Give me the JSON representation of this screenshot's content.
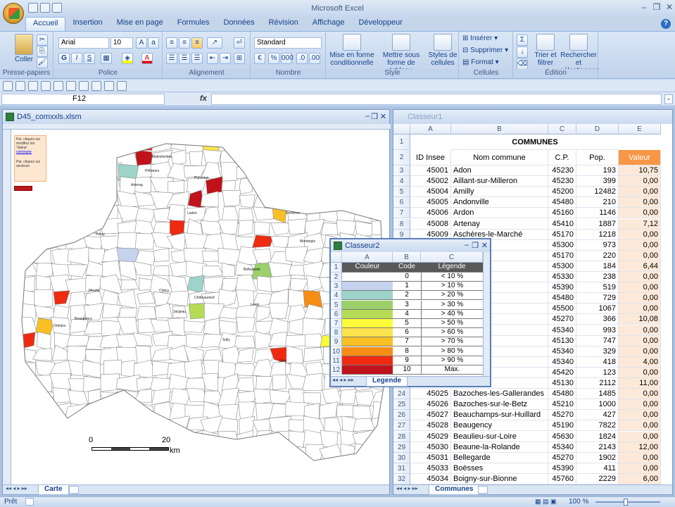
{
  "app": {
    "title": "Microsoft Excel",
    "help": "?"
  },
  "ribbon": {
    "tabs": [
      "Accueil",
      "Insertion",
      "Mise en page",
      "Formules",
      "Données",
      "Révision",
      "Affichage",
      "Développeur"
    ],
    "active_tab": "Accueil",
    "groups": {
      "clipboard": {
        "label": "Presse-papiers",
        "paste": "Coller"
      },
      "font": {
        "label": "Police",
        "font_name": "Arial",
        "font_size": "10"
      },
      "alignment": {
        "label": "Alignement"
      },
      "number": {
        "label": "Nombre",
        "format": "Standard"
      },
      "style": {
        "label": "Style",
        "cond_format": "Mise en forme conditionnelle",
        "table_format": "Mettre sous forme de tableau",
        "cell_styles": "Styles de cellules"
      },
      "cells": {
        "label": "Cellules",
        "insert": "Insérer",
        "delete": "Supprimer",
        "format": "Format"
      },
      "edit": {
        "label": "Édition",
        "sort": "Trier et filtrer",
        "find": "Rechercher et sélectionner"
      }
    }
  },
  "formula_bar": {
    "name_box": "F12",
    "fx": "fx",
    "content": ""
  },
  "windows": {
    "map": {
      "title": "D45_comxxls.xlsm",
      "sheet_tab": "Carte",
      "scale_labels": [
        "0",
        "20",
        "km"
      ],
      "info_lines": [
        "Par. cliquez sur",
        "modifiez les",
        "'Valeur'",
        "commune",
        "Par. cliquez sur",
        "secteurs"
      ],
      "communes_labels": [
        "Orléans",
        "Montargis",
        "Pithiviers",
        "Gien",
        "Briare",
        "Beaugency",
        "Sully",
        "Ladon",
        "Patay",
        "Artenay",
        "Malesherbes",
        "Puiseaux",
        "Bellegarde",
        "Lorris",
        "Châteauneuf",
        "Jargeau",
        "Meung",
        "Chécy",
        "Ferrières",
        "Courtenay"
      ]
    },
    "communes": {
      "title": "Classeur1",
      "sheet_tab": "Communes",
      "columns": [
        "A",
        "B",
        "C",
        "D",
        "E"
      ],
      "header_title": "COMMUNES",
      "headers": [
        "ID Insee",
        "Nom commune",
        "C.P.",
        "Pop.",
        "Valeur"
      ],
      "rows": [
        {
          "r": "3",
          "id": "45001",
          "nom": "Adon",
          "cp": "45230",
          "pop": "193",
          "val": "10,75"
        },
        {
          "r": "4",
          "id": "45002",
          "nom": "Aillant-sur-Milleron",
          "cp": "45230",
          "pop": "399",
          "val": "0,00"
        },
        {
          "r": "5",
          "id": "45004",
          "nom": "Amilly",
          "cp": "45200",
          "pop": "12482",
          "val": "0,00"
        },
        {
          "r": "6",
          "id": "45005",
          "nom": "Andonville",
          "cp": "45480",
          "pop": "210",
          "val": "0,00"
        },
        {
          "r": "7",
          "id": "45006",
          "nom": "Ardon",
          "cp": "45160",
          "pop": "1146",
          "val": "0,00"
        },
        {
          "r": "8",
          "id": "45008",
          "nom": "Artenay",
          "cp": "45410",
          "pop": "1887",
          "val": "7,12"
        },
        {
          "r": "9",
          "id": "45009",
          "nom": "Aschères-le-Marché",
          "cp": "45170",
          "pop": "1218",
          "val": "0,00"
        },
        {
          "r": "10",
          "id": "",
          "nom": "",
          "cp": "45300",
          "pop": "973",
          "val": "0,00"
        },
        {
          "r": "11",
          "id": "",
          "nom": "",
          "cp": "45170",
          "pop": "220",
          "val": "0,00"
        },
        {
          "r": "12",
          "id": "",
          "nom": "",
          "cp": "45300",
          "pop": "184",
          "val": "6,44"
        },
        {
          "r": "13",
          "id": "",
          "nom": "a-Rivière",
          "cp": "45330",
          "pop": "238",
          "val": "0,00"
        },
        {
          "r": "14",
          "id": "",
          "nom": "vière",
          "cp": "45390",
          "pop": "519",
          "val": "0,00"
        },
        {
          "r": "15",
          "id": "",
          "nom": "uine",
          "cp": "45480",
          "pop": "729",
          "val": "0,00"
        },
        {
          "r": "16",
          "id": "",
          "nom": "tel",
          "cp": "45500",
          "pop": "1067",
          "val": "0,00"
        },
        {
          "r": "17",
          "id": "",
          "nom": "n-Gâtinais",
          "cp": "45270",
          "pop": "366",
          "val": "10,08"
        },
        {
          "r": "18",
          "id": "",
          "nom": "",
          "cp": "45340",
          "pop": "993",
          "val": "0,00"
        },
        {
          "r": "19",
          "id": "",
          "nom": "",
          "cp": "45130",
          "pop": "747",
          "val": "0,00"
        },
        {
          "r": "20",
          "id": "",
          "nom": "Gâtinais",
          "cp": "45340",
          "pop": "329",
          "val": "0,00"
        },
        {
          "r": "21",
          "id": "",
          "nom": "âtinais",
          "cp": "45340",
          "pop": "418",
          "val": "4,00"
        },
        {
          "r": "22",
          "id": "",
          "nom": "uisaye",
          "cp": "45420",
          "pop": "123",
          "val": "0,00"
        },
        {
          "r": "23",
          "id": "",
          "nom": "",
          "cp": "45130",
          "pop": "2112",
          "val": "11,00"
        },
        {
          "r": "24",
          "id": "45025",
          "nom": "Bazoches-les-Gallerandes",
          "cp": "45480",
          "pop": "1485",
          "val": "0,00"
        },
        {
          "r": "25",
          "id": "45026",
          "nom": "Bazoches-sur-le-Betz",
          "cp": "45210",
          "pop": "1000",
          "val": "0,00"
        },
        {
          "r": "26",
          "id": "45027",
          "nom": "Beauchamps-sur-Huillard",
          "cp": "45270",
          "pop": "427",
          "val": "0,00"
        },
        {
          "r": "27",
          "id": "45028",
          "nom": "Beaugency",
          "cp": "45190",
          "pop": "7822",
          "val": "0,00"
        },
        {
          "r": "28",
          "id": "45029",
          "nom": "Beaulieu-sur-Loire",
          "cp": "45630",
          "pop": "1824",
          "val": "0,00"
        },
        {
          "r": "29",
          "id": "45030",
          "nom": "Beaune-la-Rolande",
          "cp": "45340",
          "pop": "2143",
          "val": "12,00"
        },
        {
          "r": "30",
          "id": "45031",
          "nom": "Bellegarde",
          "cp": "45270",
          "pop": "1902",
          "val": "0,00"
        },
        {
          "r": "31",
          "id": "45033",
          "nom": "Boësses",
          "cp": "45390",
          "pop": "411",
          "val": "0,00"
        },
        {
          "r": "32",
          "id": "45034",
          "nom": "Boigny-sur-Bionne",
          "cp": "45760",
          "pop": "2229",
          "val": "6,00"
        }
      ]
    },
    "legend": {
      "title": "Classeur2",
      "sheet_tab": "Legende",
      "columns": [
        "A",
        "B",
        "C"
      ],
      "headers": [
        "Couleur",
        "Code",
        "Légende"
      ],
      "rows": [
        {
          "r": "2",
          "code": "0",
          "label": "< 10 %",
          "color": "#ffffff"
        },
        {
          "r": "3",
          "code": "1",
          "label": "> 10 %",
          "color": "#c5d3ef"
        },
        {
          "r": "4",
          "code": "2",
          "label": "> 20 %",
          "color": "#9dd3c9"
        },
        {
          "r": "5",
          "code": "3",
          "label": "> 30 %",
          "color": "#9bd06b"
        },
        {
          "r": "6",
          "code": "4",
          "label": "> 40 %",
          "color": "#b6dc55"
        },
        {
          "r": "7",
          "code": "5",
          "label": "> 50 %",
          "color": "#fbfb39"
        },
        {
          "r": "8",
          "code": "6",
          "label": "> 60 %",
          "color": "#fbe44d"
        },
        {
          "r": "9",
          "code": "7",
          "label": "> 70 %",
          "color": "#f8c025"
        },
        {
          "r": "10",
          "code": "8",
          "label": "> 80 %",
          "color": "#f78d14"
        },
        {
          "r": "11",
          "code": "9",
          "label": "> 90 %",
          "color": "#ee2b10"
        },
        {
          "r": "12",
          "code": "10",
          "label": "Max.",
          "color": "#c0121b"
        }
      ]
    }
  },
  "status": {
    "ready": "Prêt",
    "zoom": "100 %"
  }
}
